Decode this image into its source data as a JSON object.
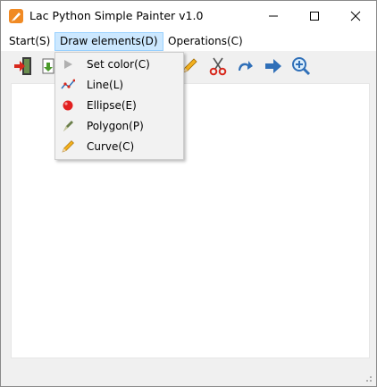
{
  "window": {
    "title": "Lac Python Simple Painter v1.0",
    "controls": [
      "minimize",
      "maximize",
      "close"
    ]
  },
  "menubar": {
    "items": [
      {
        "label": "Start(S)"
      },
      {
        "label": "Draw elements(D)",
        "active": true
      },
      {
        "label": "Operations(C)"
      }
    ]
  },
  "toolbar": {
    "icons": [
      "exit-icon",
      "save-icon",
      "pencil-icon",
      "scissors-icon",
      "redo-icon",
      "forward-arrow-icon",
      "zoom-icon"
    ]
  },
  "dropdown": {
    "items": [
      {
        "label": "Set color(C)",
        "icon": "play-triangle-icon"
      },
      {
        "label": "Line(L)",
        "icon": "line-chart-icon"
      },
      {
        "label": "Ellipse(E)",
        "icon": "red-circle-icon"
      },
      {
        "label": "Polygon(P)",
        "icon": "pen-nib-icon"
      },
      {
        "label": "Curve(C)",
        "icon": "pencil-icon"
      }
    ]
  },
  "colors": {
    "accent": "#f08a24",
    "menu_active_bg": "#cce8ff",
    "ellipse_red": "#e22020"
  }
}
